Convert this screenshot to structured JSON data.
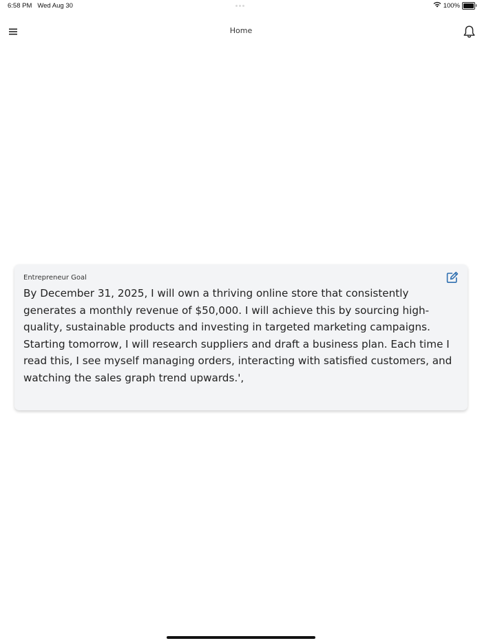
{
  "status_bar": {
    "time": "6:58 PM",
    "date": "Wed Aug 30",
    "battery_text": "100%",
    "battery_level": 1.0,
    "icons": [
      "wifi-icon",
      "battery-icon"
    ]
  },
  "nav": {
    "title": "Home",
    "menu_icon": "hamburger-menu-icon",
    "bell_icon": "bell-icon"
  },
  "goal_card": {
    "label": "Entrepreneur Goal",
    "text": "By December 31, 2025, I will own a thriving online store that consistently generates a monthly revenue of $50,000. I will achieve this by sourcing high-quality, sustainable products and investing in targeted marketing campaigns. Starting tomorrow, I will research suppliers and draft a business plan. Each time I read this, I see myself managing orders, interacting with satisfied customers, and watching the sales graph trend upwards.',",
    "edit_icon": "edit-icon"
  },
  "colors": {
    "card_background": "#f3f4f6",
    "edit_icon": "#2f6fb0",
    "text": "#222222"
  }
}
